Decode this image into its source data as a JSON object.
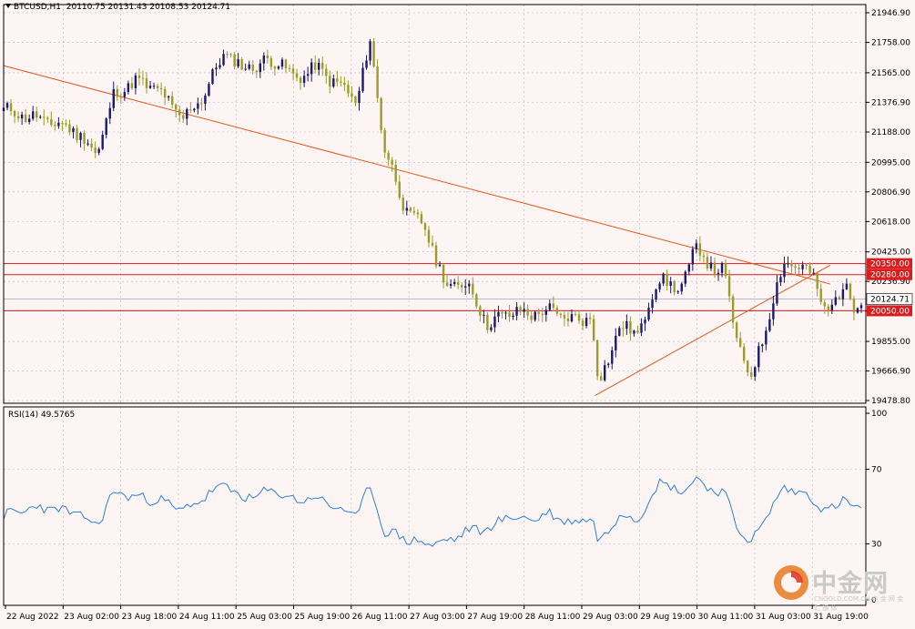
{
  "header": {
    "symbol": "BTCUSD,H1",
    "ohlc": "20110.75 20131.43 20108.53 20124.71"
  },
  "indicator": {
    "label": "RSI(14) 49.5765"
  },
  "watermark": {
    "text": "中金网",
    "sub": "CNGOLD.COM.CN  中 金 网  金  汇  通  体"
  },
  "colors": {
    "background": "#fdf4f4",
    "grid": "#b0b7c6",
    "bull_candle": "#1a1a6e",
    "bear_candle": "#9c9c2a",
    "trendline": "#e05a1a",
    "hline": "#d81e1e",
    "price_line": "#9aa6c8",
    "rsi_line": "#2f7fd8"
  },
  "chart_data": [
    {
      "type": "candlestick",
      "symbol": "BTCUSD",
      "timeframe": "H1",
      "y_ticks": [
        "21946.90",
        "21758.00",
        "21565.00",
        "21376.90",
        "21188.00",
        "20995.00",
        "20806.90",
        "20618.00",
        "20425.00",
        "20236.90",
        "20048.00",
        "19855.00",
        "19666.90",
        "19478.80"
      ],
      "ylim": [
        19460,
        21970
      ],
      "x_ticks": [
        "22 Aug 2022",
        "23 Aug 02:00",
        "23 Aug 18:00",
        "24 Aug 11:00",
        "25 Aug 03:00",
        "25 Aug 19:00",
        "26 Aug 11:00",
        "27 Aug 03:00",
        "27 Aug 19:00",
        "28 Aug 11:00",
        "29 Aug 03:00",
        "29 Aug 19:00",
        "30 Aug 11:00",
        "31 Aug 03:00",
        "31 Aug 19:00"
      ],
      "price_labels": [
        {
          "label": "20350.00",
          "value": 20350,
          "kind": "level"
        },
        {
          "label": "20280.00",
          "value": 20280,
          "kind": "level"
        },
        {
          "label": "20124.71",
          "value": 20124.71,
          "kind": "current"
        },
        {
          "label": "20050.00",
          "value": 20050,
          "kind": "level"
        }
      ],
      "trendlines": [
        {
          "from": [
            "22 Aug 00:00",
            21610
          ],
          "to": [
            "31 Aug 23:00",
            20220
          ]
        },
        {
          "from": [
            "29 Aug 03:00",
            19510
          ],
          "to": [
            "31 Aug 23:00",
            20340
          ]
        }
      ],
      "anchors": [
        [
          "22 Aug 00:00",
          21330
        ],
        [
          "22 Aug 10:00",
          21270
        ],
        [
          "22 Aug 20:00",
          21210
        ],
        [
          "23 Aug 03:00",
          21050
        ],
        [
          "23 Aug 08:00",
          21430
        ],
        [
          "23 Aug 14:00",
          21510
        ],
        [
          "23 Aug 20:00",
          21470
        ],
        [
          "24 Aug 04:00",
          21270
        ],
        [
          "24 Aug 10:00",
          21430
        ],
        [
          "24 Aug 16:00",
          21700
        ],
        [
          "24 Aug 21:00",
          21590
        ],
        [
          "25 Aug 03:00",
          21630
        ],
        [
          "25 Aug 08:00",
          21640
        ],
        [
          "25 Aug 12:00",
          21520
        ],
        [
          "25 Aug 18:00",
          21600
        ],
        [
          "26 Aug 02:00",
          21470
        ],
        [
          "26 Aug 06:00",
          21380
        ],
        [
          "26 Aug 10:00",
          21760
        ],
        [
          "26 Aug 14:00",
          21100
        ],
        [
          "26 Aug 20:00",
          20700
        ],
        [
          "27 Aug 02:00",
          20570
        ],
        [
          "27 Aug 08:00",
          20200
        ],
        [
          "27 Aug 14:00",
          20230
        ],
        [
          "27 Aug 20:00",
          19960
        ],
        [
          "28 Aug 02:00",
          20040
        ],
        [
          "28 Aug 08:00",
          20030
        ],
        [
          "28 Aug 14:00",
          20050
        ],
        [
          "28 Aug 20:00",
          19990
        ],
        [
          "29 Aug 02:00",
          20010
        ],
        [
          "29 Aug 04:00",
          19580
        ],
        [
          "29 Aug 10:00",
          19940
        ],
        [
          "29 Aug 16:00",
          19920
        ],
        [
          "29 Aug 22:00",
          20290
        ],
        [
          "30 Aug 03:00",
          20150
        ],
        [
          "30 Aug 08:00",
          20460
        ],
        [
          "30 Aug 12:00",
          20340
        ],
        [
          "30 Aug 16:00",
          20310
        ],
        [
          "30 Aug 20:00",
          19870
        ],
        [
          "31 Aug 00:00",
          19610
        ],
        [
          "31 Aug 05:00",
          20000
        ],
        [
          "31 Aug 10:00",
          20380
        ],
        [
          "31 Aug 14:00",
          20320
        ],
        [
          "31 Aug 18:00",
          20290
        ],
        [
          "31 Aug 22:00",
          20000
        ],
        [
          "1 Sep 03:00",
          20240
        ],
        [
          "1 Sep 06:00",
          20050
        ],
        [
          "1 Sep 08:00",
          20124.71
        ]
      ]
    },
    {
      "type": "line",
      "name": "RSI(14) 49.5765",
      "y_ticks": [
        "100",
        "70",
        "30",
        "0"
      ],
      "ylim": [
        0,
        100
      ],
      "current": 49.5765,
      "anchors": [
        [
          "22 Aug 00:00",
          45
        ],
        [
          "22 Aug 10:00",
          50
        ],
        [
          "22 Aug 20:00",
          47
        ],
        [
          "23 Aug 03:00",
          40
        ],
        [
          "23 Aug 08:00",
          58
        ],
        [
          "23 Aug 14:00",
          55
        ],
        [
          "23 Aug 20:00",
          54
        ],
        [
          "24 Aug 04:00",
          48
        ],
        [
          "24 Aug 10:00",
          55
        ],
        [
          "24 Aug 16:00",
          62
        ],
        [
          "24 Aug 21:00",
          54
        ],
        [
          "25 Aug 03:00",
          57
        ],
        [
          "25 Aug 08:00",
          58
        ],
        [
          "25 Aug 12:00",
          53
        ],
        [
          "25 Aug 18:00",
          55
        ],
        [
          "26 Aug 02:00",
          48
        ],
        [
          "26 Aug 06:00",
          45
        ],
        [
          "26 Aug 10:00",
          61
        ],
        [
          "26 Aug 14:00",
          37
        ],
        [
          "26 Aug 20:00",
          33
        ],
        [
          "27 Aug 02:00",
          30
        ],
        [
          "27 Aug 08:00",
          31
        ],
        [
          "27 Aug 14:00",
          37
        ],
        [
          "27 Aug 20:00",
          38
        ],
        [
          "28 Aug 02:00",
          45
        ],
        [
          "28 Aug 08:00",
          43
        ],
        [
          "28 Aug 14:00",
          46
        ],
        [
          "28 Aug 20:00",
          41
        ],
        [
          "29 Aug 02:00",
          45
        ],
        [
          "29 Aug 04:00",
          30
        ],
        [
          "29 Aug 10:00",
          46
        ],
        [
          "29 Aug 16:00",
          44
        ],
        [
          "29 Aug 22:00",
          65
        ],
        [
          "30 Aug 03:00",
          57
        ],
        [
          "30 Aug 08:00",
          65
        ],
        [
          "30 Aug 12:00",
          60
        ],
        [
          "30 Aug 16:00",
          58
        ],
        [
          "30 Aug 20:00",
          40
        ],
        [
          "31 Aug 00:00",
          30
        ],
        [
          "31 Aug 05:00",
          46
        ],
        [
          "31 Aug 10:00",
          61
        ],
        [
          "31 Aug 14:00",
          57
        ],
        [
          "31 Aug 18:00",
          55
        ],
        [
          "31 Aug 22:00",
          46
        ],
        [
          "1 Sep 03:00",
          55
        ],
        [
          "1 Sep 06:00",
          48
        ],
        [
          "1 Sep 08:00",
          49.58
        ]
      ]
    }
  ]
}
